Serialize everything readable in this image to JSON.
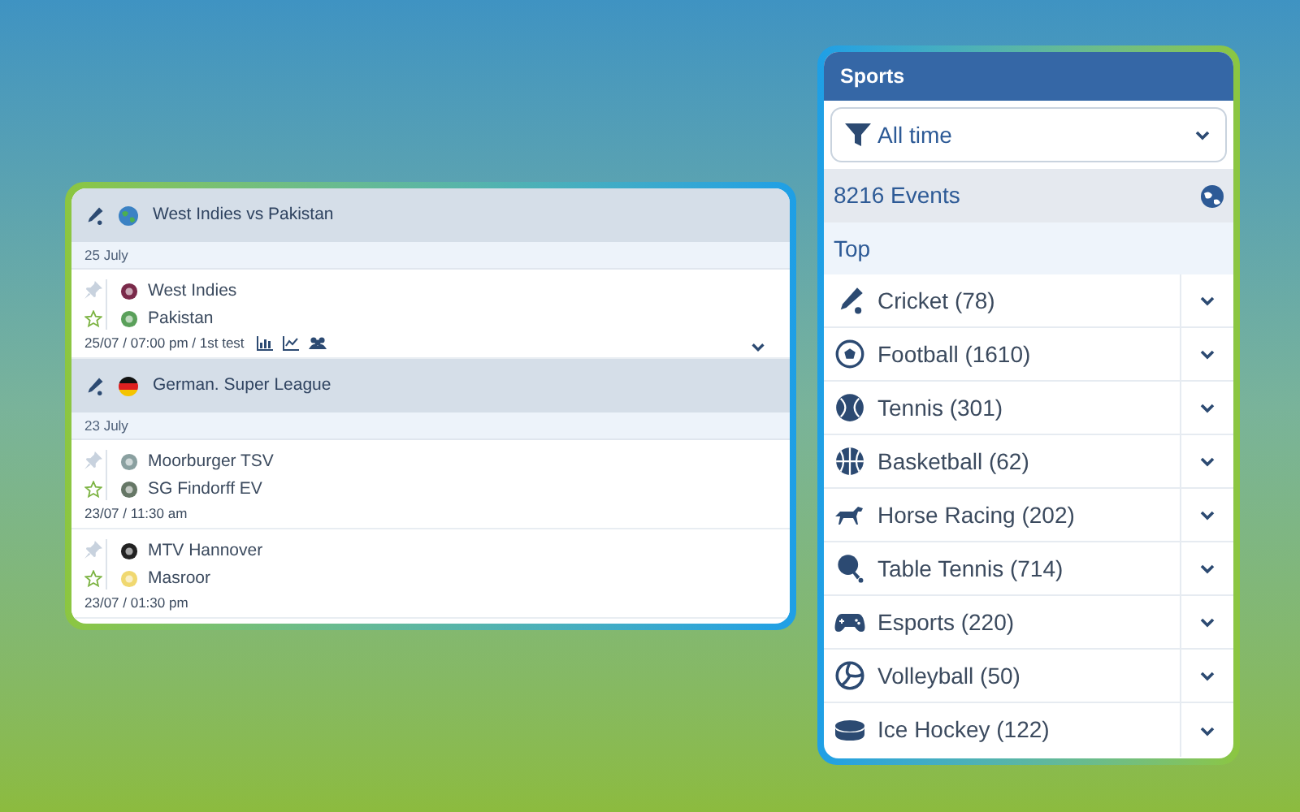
{
  "events_panel": {
    "leagues": [
      {
        "name": "West Indies vs Pakistan",
        "date": "25 July",
        "matches": [
          {
            "teams": [
              "West Indies",
              "Pakistan"
            ],
            "info": "25/07 / 07:00 pm / 1st test",
            "stats_icons": true,
            "expandable": true
          }
        ]
      },
      {
        "name": "German. Super League",
        "date": "23 July",
        "matches": [
          {
            "teams": [
              "Moorburger TSV",
              "SG Findorff EV"
            ],
            "info": "23/07 / 11:30 am",
            "stats_icons": false,
            "expandable": false
          },
          {
            "teams": [
              "MTV Hannover",
              "Masroor"
            ],
            "info": "23/07 / 01:30 pm",
            "stats_icons": false,
            "expandable": false
          }
        ]
      }
    ]
  },
  "sports_panel": {
    "title": "Sports",
    "filter": "All time",
    "events": "8216 Events",
    "section": "Top",
    "sports": [
      {
        "label": "Cricket (78)"
      },
      {
        "label": "Football (1610)"
      },
      {
        "label": "Tennis (301)"
      },
      {
        "label": "Basketball (62)"
      },
      {
        "label": "Horse Racing (202)"
      },
      {
        "label": "Table Tennis (714)"
      },
      {
        "label": "Esports (220)"
      },
      {
        "label": "Volleyball (50)"
      },
      {
        "label": "Ice Hockey (122)"
      }
    ]
  }
}
